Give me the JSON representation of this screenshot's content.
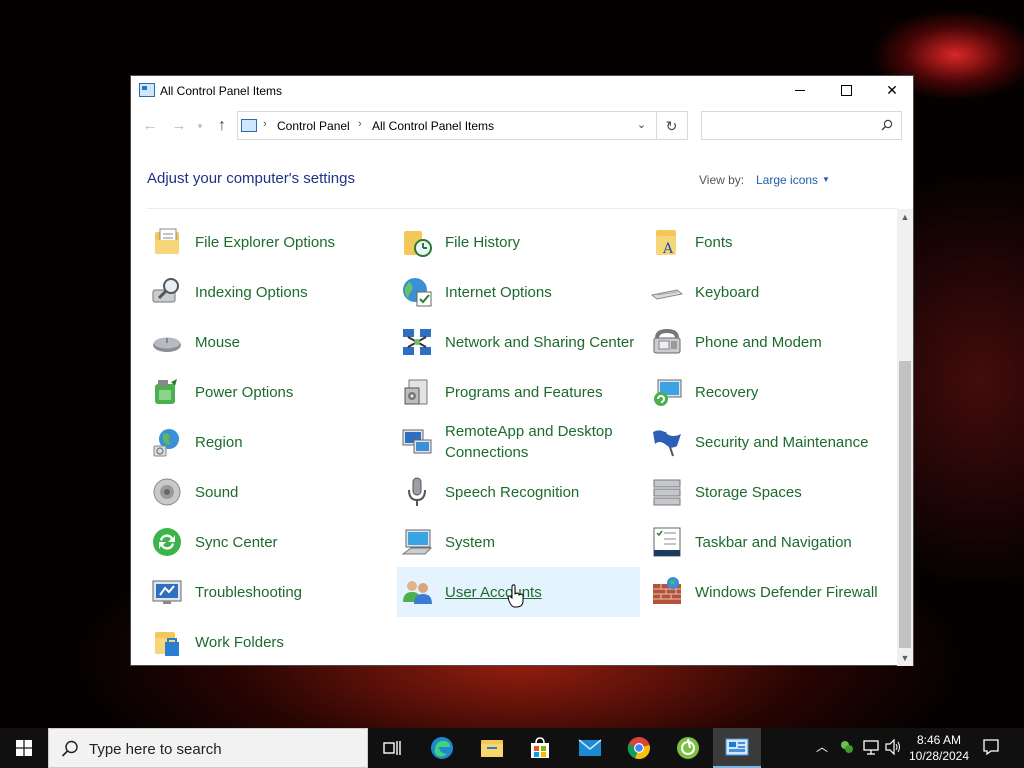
{
  "window": {
    "title": "All Control Panel Items",
    "controls": {
      "minimize": "minimize",
      "maximize": "maximize",
      "close": "✕"
    }
  },
  "address": {
    "crumbs": [
      "Control Panel",
      "All Control Panel Items"
    ],
    "search_placeholder": ""
  },
  "header": {
    "heading": "Adjust your computer's settings",
    "viewby_label": "View by:",
    "viewby_value": "Large icons"
  },
  "items": [
    {
      "label": "File Explorer Options",
      "icon": "folder-options-icon"
    },
    {
      "label": "File History",
      "icon": "file-history-icon"
    },
    {
      "label": "Fonts",
      "icon": "fonts-icon"
    },
    {
      "label": "Indexing Options",
      "icon": "indexing-icon"
    },
    {
      "label": "Internet Options",
      "icon": "internet-options-icon"
    },
    {
      "label": "Keyboard",
      "icon": "keyboard-icon"
    },
    {
      "label": "Mouse",
      "icon": "mouse-icon"
    },
    {
      "label": "Network and Sharing Center",
      "icon": "network-icon"
    },
    {
      "label": "Phone and Modem",
      "icon": "phone-icon"
    },
    {
      "label": "Power Options",
      "icon": "power-icon"
    },
    {
      "label": "Programs and Features",
      "icon": "programs-icon"
    },
    {
      "label": "Recovery",
      "icon": "recovery-icon"
    },
    {
      "label": "Region",
      "icon": "region-icon"
    },
    {
      "label": "RemoteApp and Desktop Connections",
      "icon": "remoteapp-icon"
    },
    {
      "label": "Security and Maintenance",
      "icon": "security-flag-icon"
    },
    {
      "label": "Sound",
      "icon": "sound-icon"
    },
    {
      "label": "Speech Recognition",
      "icon": "microphone-icon"
    },
    {
      "label": "Storage Spaces",
      "icon": "storage-icon"
    },
    {
      "label": "Sync Center",
      "icon": "sync-icon"
    },
    {
      "label": "System",
      "icon": "system-icon"
    },
    {
      "label": "Taskbar and Navigation",
      "icon": "taskbar-icon"
    },
    {
      "label": "Troubleshooting",
      "icon": "troubleshooting-icon"
    },
    {
      "label": "User Accounts",
      "icon": "user-accounts-icon",
      "selected": true
    },
    {
      "label": "Windows Defender Firewall",
      "icon": "firewall-icon"
    },
    {
      "label": "Work Folders",
      "icon": "work-folders-icon"
    }
  ],
  "taskbar": {
    "search_text": "Type here to search",
    "time": "8:46 AM",
    "date": "10/28/2024",
    "apps": [
      "task-view-icon",
      "edge-icon",
      "file-explorer-icon",
      "store-icon",
      "mail-icon",
      "chrome-icon",
      "greenshot-icon",
      "control-panel-icon"
    ]
  },
  "colors": {
    "link_green": "#1d6b2c",
    "heading_blue": "#1e3287",
    "selection": "#e5f3ff",
    "taskbar": "#101010"
  }
}
